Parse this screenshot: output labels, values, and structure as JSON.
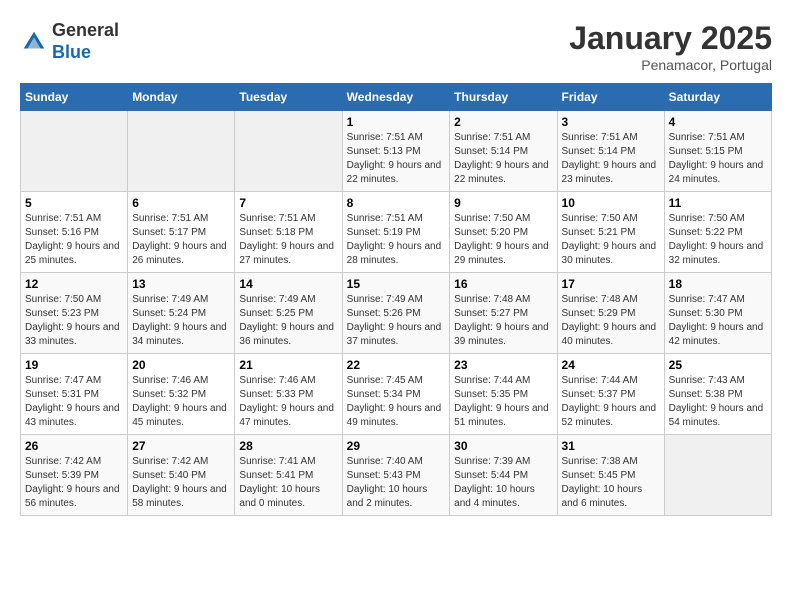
{
  "header": {
    "logo_general": "General",
    "logo_blue": "Blue",
    "month_title": "January 2025",
    "location": "Penamacor, Portugal"
  },
  "days_of_week": [
    "Sunday",
    "Monday",
    "Tuesday",
    "Wednesday",
    "Thursday",
    "Friday",
    "Saturday"
  ],
  "weeks": [
    [
      {
        "day": "",
        "sunrise": "",
        "sunset": "",
        "daylight": ""
      },
      {
        "day": "",
        "sunrise": "",
        "sunset": "",
        "daylight": ""
      },
      {
        "day": "",
        "sunrise": "",
        "sunset": "",
        "daylight": ""
      },
      {
        "day": "1",
        "sunrise": "Sunrise: 7:51 AM",
        "sunset": "Sunset: 5:13 PM",
        "daylight": "Daylight: 9 hours and 22 minutes."
      },
      {
        "day": "2",
        "sunrise": "Sunrise: 7:51 AM",
        "sunset": "Sunset: 5:14 PM",
        "daylight": "Daylight: 9 hours and 22 minutes."
      },
      {
        "day": "3",
        "sunrise": "Sunrise: 7:51 AM",
        "sunset": "Sunset: 5:14 PM",
        "daylight": "Daylight: 9 hours and 23 minutes."
      },
      {
        "day": "4",
        "sunrise": "Sunrise: 7:51 AM",
        "sunset": "Sunset: 5:15 PM",
        "daylight": "Daylight: 9 hours and 24 minutes."
      }
    ],
    [
      {
        "day": "5",
        "sunrise": "Sunrise: 7:51 AM",
        "sunset": "Sunset: 5:16 PM",
        "daylight": "Daylight: 9 hours and 25 minutes."
      },
      {
        "day": "6",
        "sunrise": "Sunrise: 7:51 AM",
        "sunset": "Sunset: 5:17 PM",
        "daylight": "Daylight: 9 hours and 26 minutes."
      },
      {
        "day": "7",
        "sunrise": "Sunrise: 7:51 AM",
        "sunset": "Sunset: 5:18 PM",
        "daylight": "Daylight: 9 hours and 27 minutes."
      },
      {
        "day": "8",
        "sunrise": "Sunrise: 7:51 AM",
        "sunset": "Sunset: 5:19 PM",
        "daylight": "Daylight: 9 hours and 28 minutes."
      },
      {
        "day": "9",
        "sunrise": "Sunrise: 7:50 AM",
        "sunset": "Sunset: 5:20 PM",
        "daylight": "Daylight: 9 hours and 29 minutes."
      },
      {
        "day": "10",
        "sunrise": "Sunrise: 7:50 AM",
        "sunset": "Sunset: 5:21 PM",
        "daylight": "Daylight: 9 hours and 30 minutes."
      },
      {
        "day": "11",
        "sunrise": "Sunrise: 7:50 AM",
        "sunset": "Sunset: 5:22 PM",
        "daylight": "Daylight: 9 hours and 32 minutes."
      }
    ],
    [
      {
        "day": "12",
        "sunrise": "Sunrise: 7:50 AM",
        "sunset": "Sunset: 5:23 PM",
        "daylight": "Daylight: 9 hours and 33 minutes."
      },
      {
        "day": "13",
        "sunrise": "Sunrise: 7:49 AM",
        "sunset": "Sunset: 5:24 PM",
        "daylight": "Daylight: 9 hours and 34 minutes."
      },
      {
        "day": "14",
        "sunrise": "Sunrise: 7:49 AM",
        "sunset": "Sunset: 5:25 PM",
        "daylight": "Daylight: 9 hours and 36 minutes."
      },
      {
        "day": "15",
        "sunrise": "Sunrise: 7:49 AM",
        "sunset": "Sunset: 5:26 PM",
        "daylight": "Daylight: 9 hours and 37 minutes."
      },
      {
        "day": "16",
        "sunrise": "Sunrise: 7:48 AM",
        "sunset": "Sunset: 5:27 PM",
        "daylight": "Daylight: 9 hours and 39 minutes."
      },
      {
        "day": "17",
        "sunrise": "Sunrise: 7:48 AM",
        "sunset": "Sunset: 5:29 PM",
        "daylight": "Daylight: 9 hours and 40 minutes."
      },
      {
        "day": "18",
        "sunrise": "Sunrise: 7:47 AM",
        "sunset": "Sunset: 5:30 PM",
        "daylight": "Daylight: 9 hours and 42 minutes."
      }
    ],
    [
      {
        "day": "19",
        "sunrise": "Sunrise: 7:47 AM",
        "sunset": "Sunset: 5:31 PM",
        "daylight": "Daylight: 9 hours and 43 minutes."
      },
      {
        "day": "20",
        "sunrise": "Sunrise: 7:46 AM",
        "sunset": "Sunset: 5:32 PM",
        "daylight": "Daylight: 9 hours and 45 minutes."
      },
      {
        "day": "21",
        "sunrise": "Sunrise: 7:46 AM",
        "sunset": "Sunset: 5:33 PM",
        "daylight": "Daylight: 9 hours and 47 minutes."
      },
      {
        "day": "22",
        "sunrise": "Sunrise: 7:45 AM",
        "sunset": "Sunset: 5:34 PM",
        "daylight": "Daylight: 9 hours and 49 minutes."
      },
      {
        "day": "23",
        "sunrise": "Sunrise: 7:44 AM",
        "sunset": "Sunset: 5:35 PM",
        "daylight": "Daylight: 9 hours and 51 minutes."
      },
      {
        "day": "24",
        "sunrise": "Sunrise: 7:44 AM",
        "sunset": "Sunset: 5:37 PM",
        "daylight": "Daylight: 9 hours and 52 minutes."
      },
      {
        "day": "25",
        "sunrise": "Sunrise: 7:43 AM",
        "sunset": "Sunset: 5:38 PM",
        "daylight": "Daylight: 9 hours and 54 minutes."
      }
    ],
    [
      {
        "day": "26",
        "sunrise": "Sunrise: 7:42 AM",
        "sunset": "Sunset: 5:39 PM",
        "daylight": "Daylight: 9 hours and 56 minutes."
      },
      {
        "day": "27",
        "sunrise": "Sunrise: 7:42 AM",
        "sunset": "Sunset: 5:40 PM",
        "daylight": "Daylight: 9 hours and 58 minutes."
      },
      {
        "day": "28",
        "sunrise": "Sunrise: 7:41 AM",
        "sunset": "Sunset: 5:41 PM",
        "daylight": "Daylight: 10 hours and 0 minutes."
      },
      {
        "day": "29",
        "sunrise": "Sunrise: 7:40 AM",
        "sunset": "Sunset: 5:43 PM",
        "daylight": "Daylight: 10 hours and 2 minutes."
      },
      {
        "day": "30",
        "sunrise": "Sunrise: 7:39 AM",
        "sunset": "Sunset: 5:44 PM",
        "daylight": "Daylight: 10 hours and 4 minutes."
      },
      {
        "day": "31",
        "sunrise": "Sunrise: 7:38 AM",
        "sunset": "Sunset: 5:45 PM",
        "daylight": "Daylight: 10 hours and 6 minutes."
      },
      {
        "day": "",
        "sunrise": "",
        "sunset": "",
        "daylight": ""
      }
    ]
  ]
}
